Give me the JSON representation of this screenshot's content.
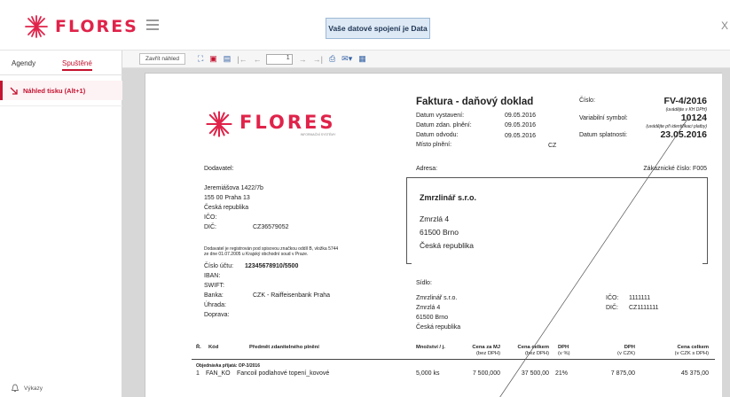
{
  "header": {
    "brand": "FLORES",
    "banner": "Vaše datové spojení je Data",
    "close_glyph": "X"
  },
  "sidebar": {
    "tabs": [
      "Agendy",
      "Spuštěné"
    ],
    "active_item": "Náhled tisku (Alt+1)",
    "footer": "Výkazy"
  },
  "toolbar": {
    "close_label": "Zavřít náhled",
    "page_value": "1"
  },
  "invoice": {
    "logo_text": "FLORES",
    "logo_subtitle": "INFORMAČNÍ SYSTÉMY",
    "title": "Faktura - daňový doklad",
    "fields": [
      {
        "label": "Datum vystavení:",
        "value": "09.05.2016"
      },
      {
        "label": "Datum zdan. plnění:",
        "value": "09.05.2016"
      },
      {
        "label": "Datum odvodu:",
        "value": "09.05.2016"
      },
      {
        "label": "Místo plnění:",
        "value": "CZ"
      }
    ],
    "cislo_label": "Číslo:",
    "cislo_value": "FV-4/2016",
    "cislo_note": "(uvádějte v KH DPH)",
    "vs_label": "Variabilní symbol:",
    "vs_value": "10124",
    "vs_note": "(uvádějte při identifikaci platby)",
    "splatnost_label": "Datum splatnosti:",
    "splatnost_value": "23.05.2016",
    "dodavatel_label": "Dodavatel:",
    "adresa_label": "Adresa:",
    "zakaznicke_label": "Zákaznické číslo: F005",
    "supplier": {
      "street": "Jeremiášova 1422/7b",
      "city": "155 00  Praha 13",
      "country": "Česká republika",
      "ico_label": "IČO:",
      "dic_label": "DIČ:",
      "dic_value": "CZ36579052",
      "registry_line1": "Dodavatel je registrován pod spisovou značkou oddíl B, vložka 5744",
      "registry_line2": "ze dne 01.07.2005 u Krajský obchodní soud v Praze.",
      "ucet_label": "Číslo účtu:",
      "ucet_value": "12345678910/5500",
      "iban_label": "IBAN:",
      "swift_label": "SWIFT:",
      "banka_label": "Banka:",
      "banka_value": "CZK - Raiffeisenbank Praha",
      "uhrada_label": "Úhrada:",
      "doprava_label": "Doprava:"
    },
    "customer": {
      "name": "Zmrzlinář s.r.o.",
      "street": "Zmrzlá 4",
      "city": "61500  Brno",
      "country": "Česká republika"
    },
    "sidlo": {
      "label": "Sídlo:",
      "name": "Zmrzlinář s.r.o.",
      "street": "Zmrzlá 4",
      "city": "61500  Brno",
      "country": "Česká republika",
      "ico_label": "IČO:",
      "ico_value": "1111111",
      "dic_label": "DIČ:",
      "dic_value": "CZ1111111"
    },
    "table": {
      "h_r": "Ř.",
      "h_kod": "Kód",
      "h_predmet": "Předmět zdanitelného plnění",
      "h_mnozstvi": "Množství / j.",
      "h_cena_mj": "Cena za MJ",
      "h_cena_mj_sub": "(bez DPH)",
      "h_cena_celkem": "Cena celkem",
      "h_cena_celkem_sub": "(bez DPH)",
      "h_dph": "DPH",
      "h_dph_sub": "(v %)",
      "h_dph_czk": "DPH",
      "h_dph_czk_sub": "(v CZK)",
      "h_total": "Cena celkem",
      "h_total_sub": "(v CZK s DPH)",
      "order_label": "Objednávka přijatá: OP-3/2016",
      "rows": [
        {
          "r": "1",
          "kod": "FAN_KO",
          "predmet": "Fancoil podlahové topení_kovové",
          "mnozstvi": "5,000 ks",
          "cena_mj": "7 500,000",
          "cena_celkem": "37 500,00",
          "dph": "21%",
          "dph_czk": "7 875,00",
          "total": "45 375,00"
        }
      ]
    }
  }
}
